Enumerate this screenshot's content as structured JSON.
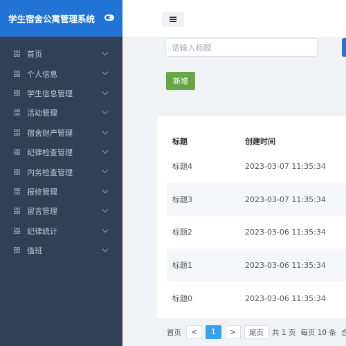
{
  "sidebar": {
    "title": "学生宿舍公寓管理系统",
    "items": [
      {
        "label": "首页"
      },
      {
        "label": "个人信息"
      },
      {
        "label": "学生信息管理"
      },
      {
        "label": "活动管理"
      },
      {
        "label": "宿舍财产管理"
      },
      {
        "label": "纪律检查管理"
      },
      {
        "label": "内务检查管理"
      },
      {
        "label": "报修管理"
      },
      {
        "label": "留言管理"
      },
      {
        "label": "纪律统计"
      },
      {
        "label": "值班"
      }
    ]
  },
  "search": {
    "placeholder": "请输入标题"
  },
  "toolbar": {
    "add_label": "新增"
  },
  "table": {
    "headers": [
      "标题",
      "创建时间"
    ],
    "rows": [
      [
        "标题4",
        "2023-03-07 11:35:34"
      ],
      [
        "标题3",
        "2023-03-07 11:35:34"
      ],
      [
        "标题2",
        "2023-03-06 11:35:34"
      ],
      [
        "标题1",
        "2023-03-06 11:35:34"
      ],
      [
        "标题0",
        "2023-03-06 11:35:34"
      ]
    ]
  },
  "pagination": {
    "first": "首页",
    "prev": "<",
    "current": "1",
    "next": ">",
    "last": "尾页",
    "total_pages": "共 1 页",
    "per_page": "每页 10 条",
    "extra": "合"
  }
}
